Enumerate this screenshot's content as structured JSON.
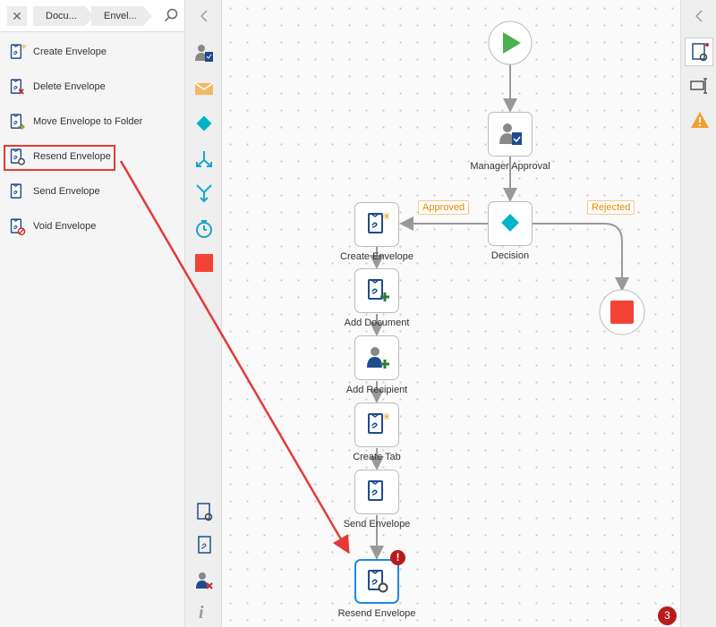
{
  "breadcrumb": {
    "items": [
      "Docu...",
      "Envel..."
    ]
  },
  "actions": [
    {
      "label": "Create Envelope",
      "icon": "create-envelope-icon"
    },
    {
      "label": "Delete Envelope",
      "icon": "delete-envelope-icon"
    },
    {
      "label": "Move Envelope to Folder",
      "icon": "move-envelope-icon"
    },
    {
      "label": "Resend Envelope",
      "icon": "resend-envelope-icon"
    },
    {
      "label": "Send Envelope",
      "icon": "send-envelope-icon"
    },
    {
      "label": "Void Envelope",
      "icon": "void-envelope-icon"
    }
  ],
  "flow": {
    "nodes": {
      "manager": "Manager Approval",
      "decision": "Decision",
      "create": "Create Envelope",
      "doc": "Add Document",
      "recip": "Add Recipient",
      "tab": "Create Tab",
      "send": "Send Envelope",
      "resend": "Resend Envelope"
    },
    "branches": {
      "approved": "Approved",
      "rejected": "Rejected"
    },
    "warning": "!"
  },
  "error_count": "3",
  "colors": {
    "accent": "#1e88e5",
    "arrow": "#e53935",
    "decision": "#00b4c8",
    "stop": "#f44336",
    "start": "#4caf50",
    "tag": "#e08a00"
  }
}
